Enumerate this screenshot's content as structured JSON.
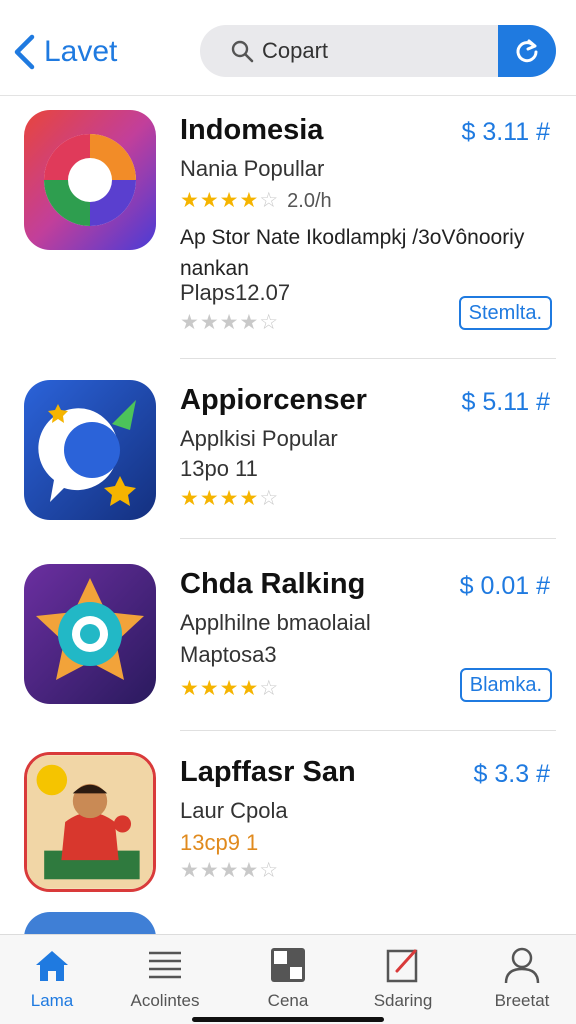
{
  "header": {
    "back_label": "Lavet",
    "search_value": "Copart"
  },
  "apps": [
    {
      "name": "Indomesia",
      "subtitle": "Nania Popullar",
      "price": "$ 3.11 #",
      "rating_count": "2.0/h",
      "description": "Ap  Stor Nate Ikodlampkj /3oVônooriy nankan",
      "meta": "Plaps12.07",
      "button_label": "Stemlta."
    },
    {
      "name": "Appiorcenser",
      "subtitle": "Applkisi Popular",
      "price": "$ 5.11 #",
      "meta": "13po 11"
    },
    {
      "name": "Chda Ralking",
      "subtitle": "Applhilne bmaolaial",
      "price": "$ 0.01 #",
      "meta": "Maptosa3",
      "button_label": "Blamka."
    },
    {
      "name": "Lapffasr San",
      "subtitle": "Laur Cpola",
      "price": "$ 3.3 #",
      "meta": "13cp9 1"
    }
  ],
  "tabs": [
    {
      "label": "Lama",
      "icon": "home-icon",
      "active": true
    },
    {
      "label": "Acolintes",
      "icon": "list-icon"
    },
    {
      "label": "Cena",
      "icon": "grid-icon"
    },
    {
      "label": "Sdaring",
      "icon": "edit-icon"
    },
    {
      "label": "Breetat",
      "icon": "person-icon"
    }
  ],
  "colors": {
    "accent": "#1f7ae0",
    "star": "#f5b400"
  }
}
